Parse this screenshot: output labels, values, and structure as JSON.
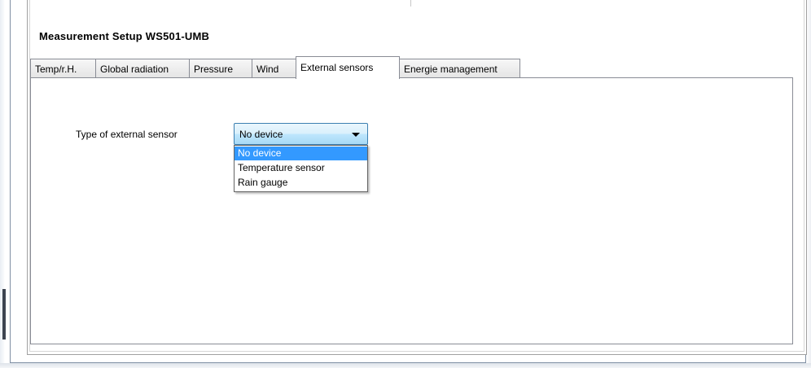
{
  "window": {
    "title": "Measurement Setup  WS501-UMB"
  },
  "tabs": [
    {
      "label": "Temp/r.H.",
      "active": false
    },
    {
      "label": "Global radiation",
      "active": false
    },
    {
      "label": "Pressure",
      "active": false
    },
    {
      "label": "Wind",
      "active": false
    },
    {
      "label": "External sensors",
      "active": true
    },
    {
      "label": "Energie management",
      "active": false
    }
  ],
  "external_sensors": {
    "label": "Type of external sensor",
    "selected_value": "No device",
    "options": [
      "No device",
      "Temperature sensor",
      "Rain gauge"
    ],
    "highlighted_option": "No device"
  },
  "colors": {
    "selection": "#3399ff",
    "combo_border": "#3c7fb1"
  }
}
